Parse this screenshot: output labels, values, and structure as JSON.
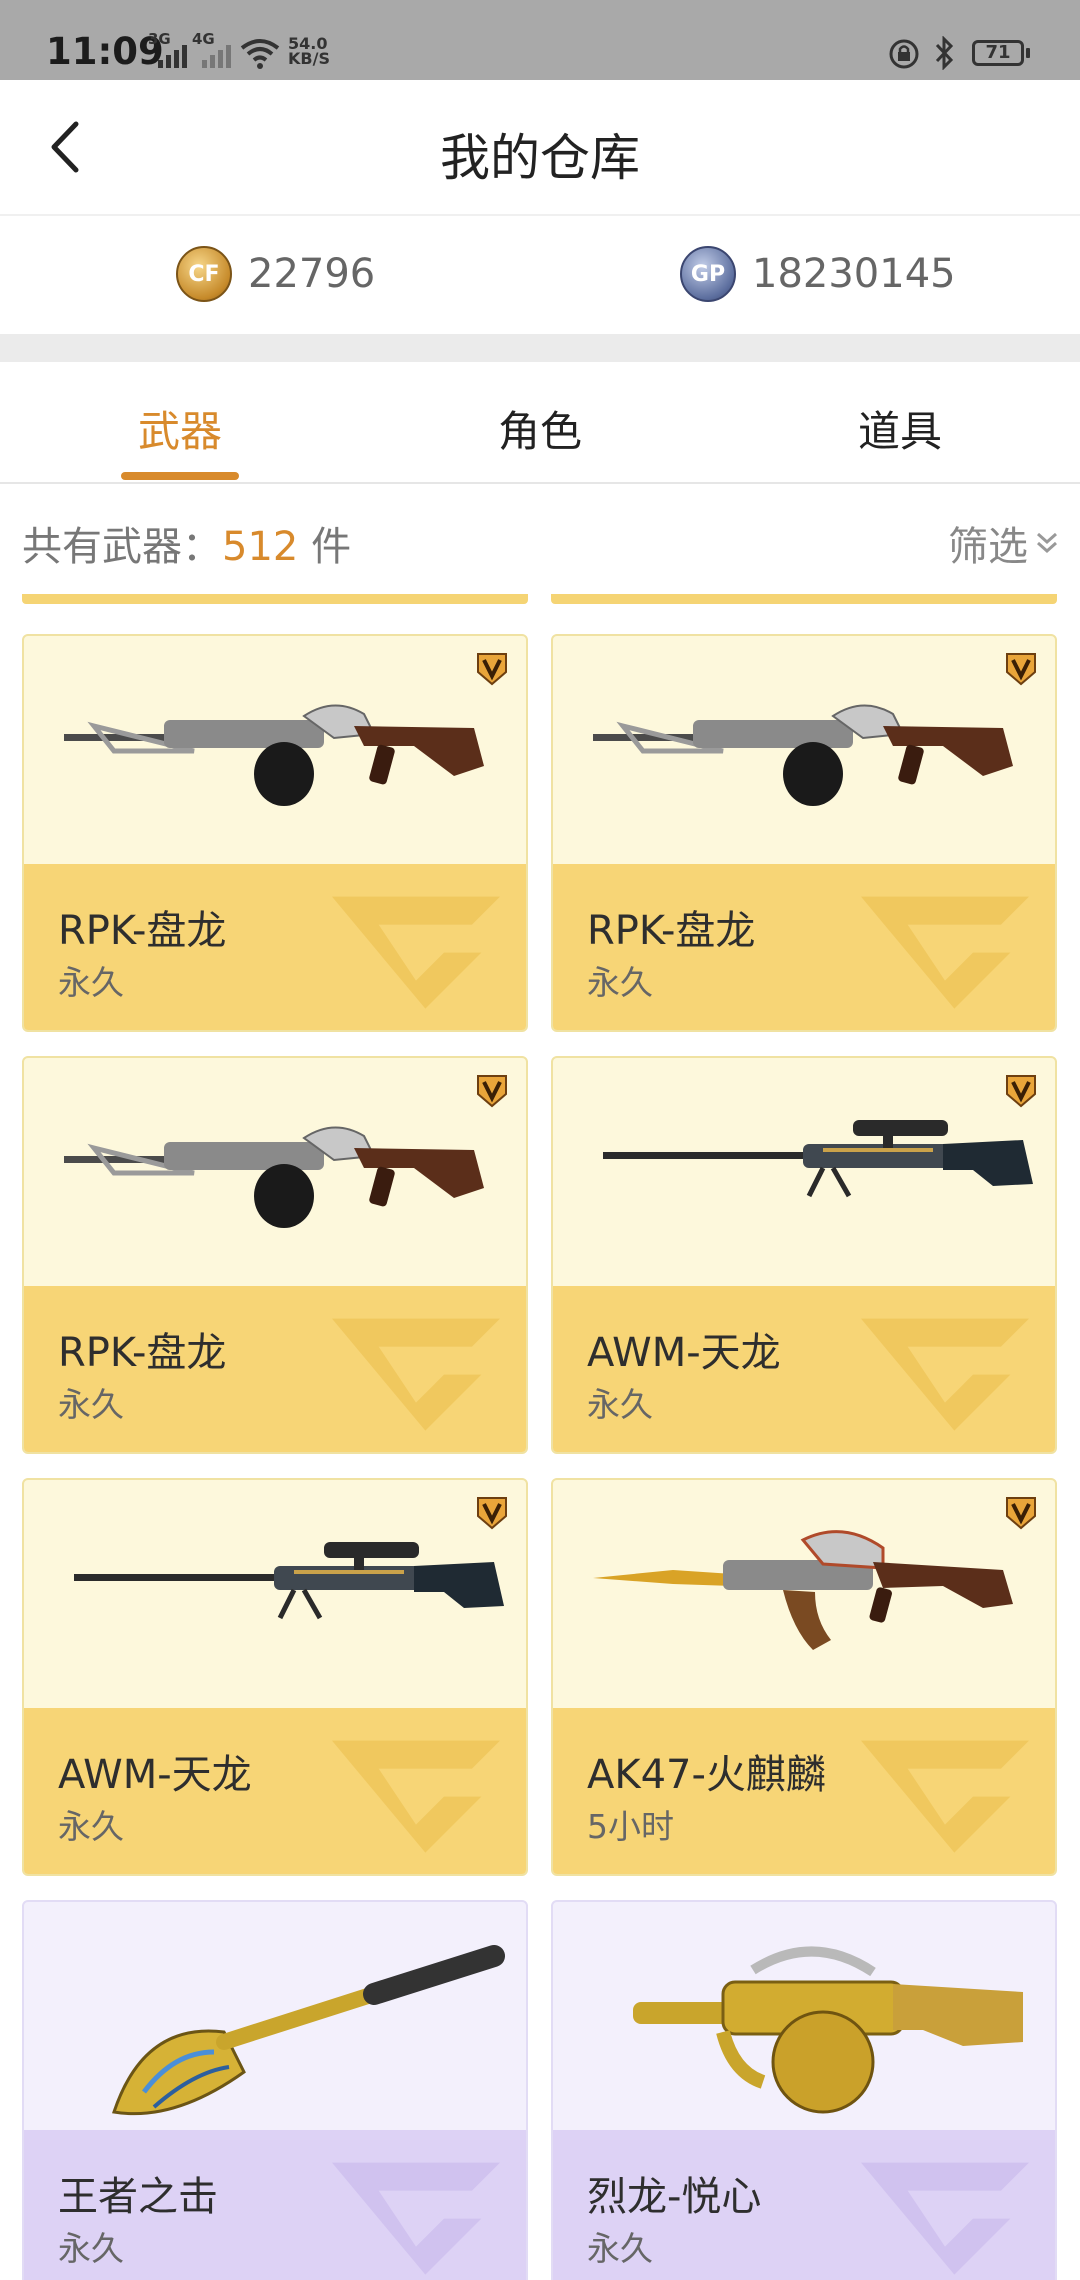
{
  "status_bar": {
    "time": "11:09",
    "net1": "3G",
    "net2": "4G",
    "speed_value": "54.0",
    "speed_unit": "KB/S",
    "battery": "71"
  },
  "header": {
    "title": "我的仓库"
  },
  "currency": {
    "cf_icon": "CF",
    "cf_amount": "22796",
    "gp_icon": "GP",
    "gp_amount": "18230145"
  },
  "tabs": [
    {
      "label": "武器",
      "active": true
    },
    {
      "label": "角色",
      "active": false
    },
    {
      "label": "道具",
      "active": false
    }
  ],
  "summary": {
    "prefix": "共有武器：",
    "count": "512",
    "unit": " 件",
    "filter_label": "筛选"
  },
  "items": [
    {
      "name": "RPK-盘龙",
      "duration": "永久",
      "theme": "gold",
      "weapon": "rpk",
      "vip": true
    },
    {
      "name": "RPK-盘龙",
      "duration": "永久",
      "theme": "gold",
      "weapon": "rpk",
      "vip": true
    },
    {
      "name": "RPK-盘龙",
      "duration": "永久",
      "theme": "gold",
      "weapon": "rpk",
      "vip": true
    },
    {
      "name": "AWM-天龙",
      "duration": "永久",
      "theme": "gold",
      "weapon": "awm",
      "vip": true
    },
    {
      "name": "AWM-天龙",
      "duration": "永久",
      "theme": "gold",
      "weapon": "awm",
      "vip": true
    },
    {
      "name": "AK47-火麒麟",
      "duration": "5小时",
      "theme": "gold",
      "weapon": "ak47",
      "vip": true
    },
    {
      "name": "王者之击",
      "duration": "永久",
      "theme": "purple",
      "weapon": "shovel",
      "vip": false
    },
    {
      "name": "烈龙-悦心",
      "duration": "永久",
      "theme": "purple",
      "weapon": "tommy",
      "vip": false
    }
  ],
  "colors": {
    "accent": "#d88a2c",
    "card_gold_top": "#fdf8dc",
    "card_gold_bottom": "#f7d576",
    "card_purple_top": "#f3f0fc",
    "card_purple_bottom": "#ddd2f5"
  }
}
